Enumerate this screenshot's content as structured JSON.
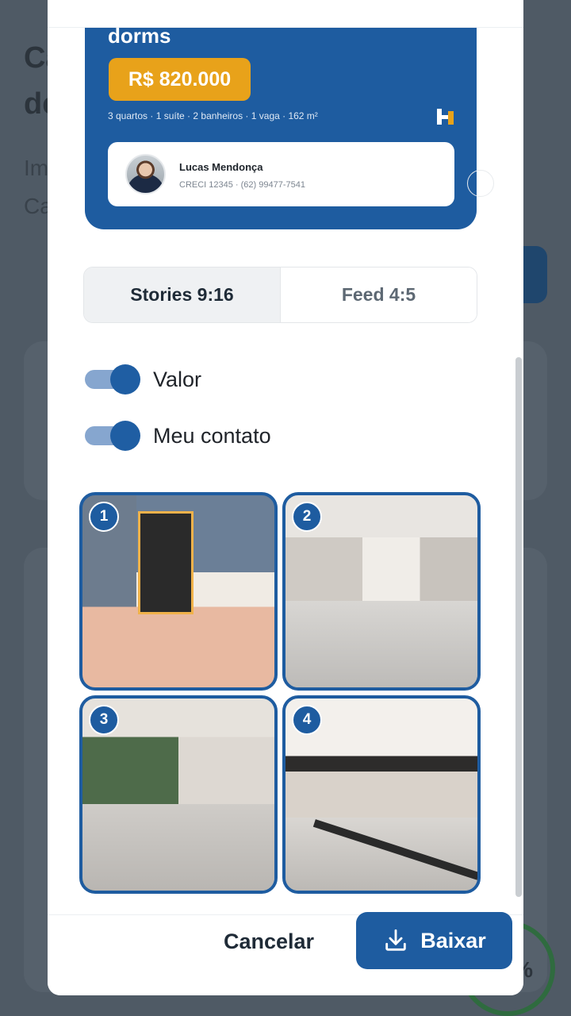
{
  "background": {
    "title_fragment": "Ca",
    "title_fragment2": "de",
    "line_fragment": "Im",
    "line_fragment2": "Ca"
  },
  "preview": {
    "title_partial": "dorms",
    "price": "R$ 820.000",
    "specs": "3 quartos · 1 suíte · 2 banheiros · 1 vaga · 162 m²",
    "brand_icon": "h-logo-icon",
    "contact": {
      "name": "Lucas Mendonça",
      "details": "CRECI 12345 · (62) 99477-7541"
    }
  },
  "formats": {
    "tabs": [
      {
        "label": "Stories 9:16",
        "active": true
      },
      {
        "label": "Feed 4:5",
        "active": false
      }
    ]
  },
  "toggles": [
    {
      "label": "Valor",
      "on": true
    },
    {
      "label": "Meu contato",
      "on": true
    }
  ],
  "photos": [
    {
      "number": "1"
    },
    {
      "number": "2"
    },
    {
      "number": "3"
    },
    {
      "number": "4"
    }
  ],
  "footer": {
    "cancel_label": "Cancelar",
    "download_label": "Baixar",
    "download_icon": "download-icon"
  },
  "colors": {
    "primary": "#1e5ca0",
    "price_badge": "#e8a21a",
    "toggle_track": "#86a6cf"
  }
}
